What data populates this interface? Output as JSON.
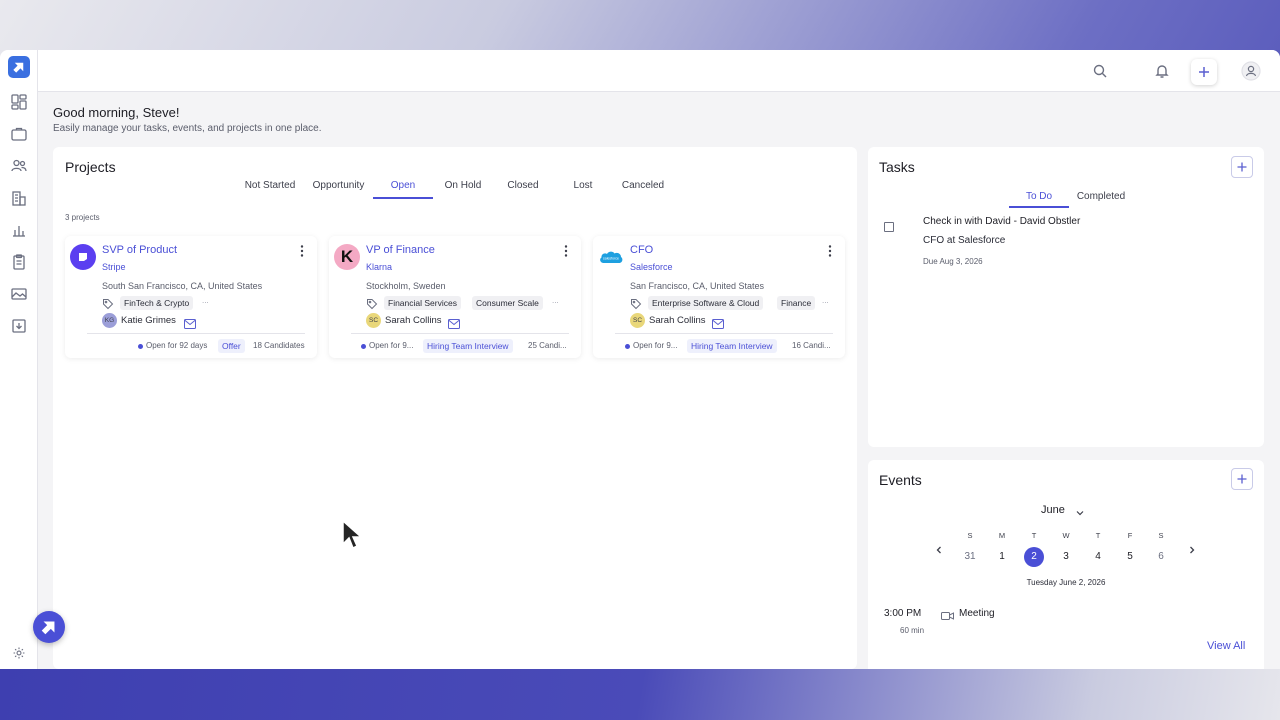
{
  "colors": {
    "accent": "#4a4fd6",
    "logo_bg": "#3a6fe0"
  },
  "sidebar": {
    "icons": [
      "dashboard-icon",
      "briefcase-icon",
      "people-icon",
      "building-icon",
      "bar-chart-icon",
      "clipboard-icon",
      "image-icon",
      "download-icon",
      "gear-icon"
    ]
  },
  "header": {
    "greeting": "Good morning, Steve!",
    "subtitle": "Easily manage your tasks, events, and projects in one place."
  },
  "projects": {
    "title": "Projects",
    "tabs": [
      "Not Started",
      "Opportunity",
      "Open",
      "On Hold",
      "Closed",
      "Lost",
      "Canceled"
    ],
    "active_tab": "Open",
    "count": "3 projects",
    "cards": [
      {
        "title": "SVP of Product",
        "company": "Stripe",
        "location": "South San Francisco, CA, United States",
        "tags": [
          "FinTech & Crypto"
        ],
        "more": "...",
        "initials": "KG",
        "person": "Katie Grimes",
        "open_for": "Open for 92 days",
        "stage": "Offer",
        "candidates": "18 Candidates"
      },
      {
        "title": "VP of Finance",
        "company": "Klarna",
        "location": "Stockholm, Sweden",
        "tags": [
          "Financial Services",
          "Consumer Scale"
        ],
        "more": "...",
        "initials": "SC",
        "person": "Sarah Collins",
        "open_for": "Open for 9...",
        "stage": "Hiring Team Interview",
        "candidates": "25 Candi..."
      },
      {
        "title": "CFO",
        "company": "Salesforce",
        "location": "San Francisco, CA, United States",
        "tags": [
          "Enterprise Software & Cloud",
          "Finance"
        ],
        "more": "...",
        "initials": "SC",
        "person": "Sarah Collins",
        "open_for": "Open for 9...",
        "stage": "Hiring Team Interview",
        "candidates": "16 Candi..."
      }
    ]
  },
  "tasks": {
    "title": "Tasks",
    "tabs": [
      "To Do",
      "Completed"
    ],
    "active_tab": "To Do",
    "items": [
      {
        "title": "Check in with David - David Obstler",
        "subtitle": "CFO at Salesforce",
        "due": "Due Aug 3, 2026"
      }
    ]
  },
  "events": {
    "title": "Events",
    "month": "June",
    "days": [
      {
        "dow": "S",
        "day": "31"
      },
      {
        "dow": "M",
        "day": "1"
      },
      {
        "dow": "T",
        "day": "2"
      },
      {
        "dow": "W",
        "day": "3"
      },
      {
        "dow": "T",
        "day": "4"
      },
      {
        "dow": "F",
        "day": "5"
      },
      {
        "dow": "S",
        "day": "6"
      }
    ],
    "selected_day": "2",
    "selected_date": "Tuesday June 2, 2026",
    "items": [
      {
        "time": "3:00 PM",
        "duration": "60 min",
        "name": "Meeting"
      }
    ],
    "view_all": "View All"
  }
}
